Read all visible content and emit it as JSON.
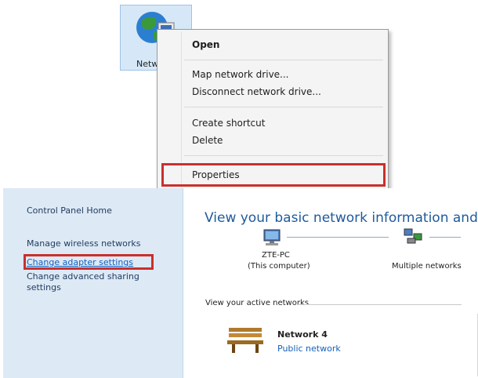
{
  "desktop_icon": {
    "label": "Netw"
  },
  "context_menu": {
    "items": [
      {
        "label": "Open"
      },
      {
        "label": "Map network drive..."
      },
      {
        "label": "Disconnect network drive..."
      },
      {
        "label": "Create shortcut"
      },
      {
        "label": "Delete"
      },
      {
        "label": "Properties"
      }
    ],
    "highlighted": "Properties"
  },
  "control_panel": {
    "sidebar": {
      "home": "Control Panel Home",
      "links": [
        {
          "label": "Manage wireless networks"
        },
        {
          "label": "Change adapter settings"
        },
        {
          "label": "Change advanced sharing"
        },
        {
          "label": "settings"
        }
      ],
      "highlighted": "Change adapter settings"
    },
    "main": {
      "title": "View your basic network information and se",
      "computer": {
        "name": "ZTE-PC",
        "subtitle": "(This computer)"
      },
      "network_node": {
        "label": "Multiple networks"
      },
      "active_networks_header": "View your active networks",
      "active_network": {
        "name": "Network 4",
        "type": "Public network"
      }
    }
  },
  "colors": {
    "highlight_border": "#c9302c",
    "sidebar_bg": "#dde9f5",
    "link_color": "#1560bd",
    "title_color": "#1e5a9c"
  }
}
